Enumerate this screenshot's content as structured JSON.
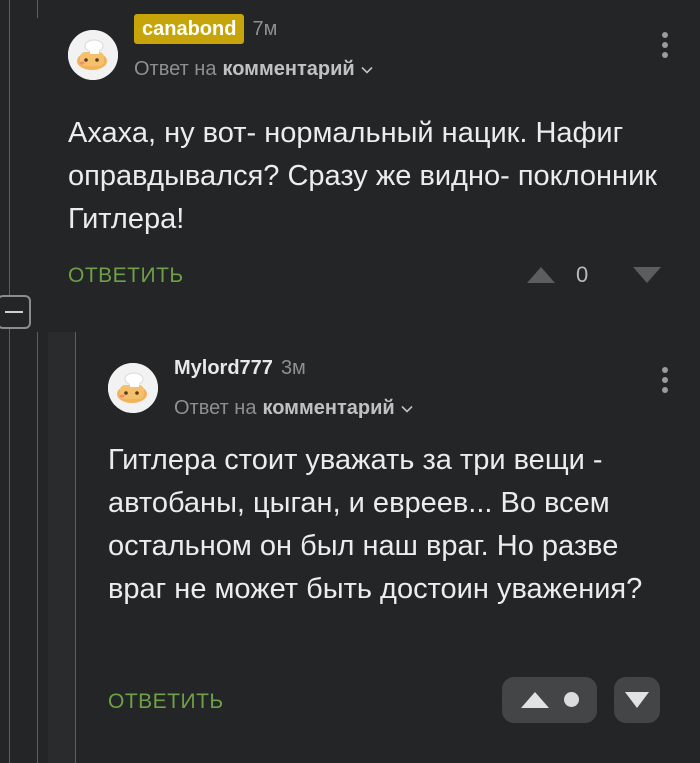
{
  "comments": [
    {
      "author": "canabond",
      "time": "7м",
      "reply_prefix": "Ответ на",
      "reply_target": "комментарий",
      "text": "Ахаха, ну вот- нормальный нацик. Нафиг оправдывался? Сразу же видно- поклонник Гитлера!",
      "reply_label": "ОТВЕТИТЬ",
      "score": "0"
    },
    {
      "author": "Mylord777",
      "time": "3м",
      "reply_prefix": "Ответ на",
      "reply_target": "комментарий",
      "text": "Гитлера стоит уважать за три вещи - автобаны, цыган, и евреев... Во всем остальном он был наш враг. Но разве враг не может быть достоин уважения?",
      "reply_label": "ОТВЕТИТЬ"
    }
  ],
  "colors": {
    "background": "#242526",
    "author_badge": "#c6a40a",
    "reply_link": "#6da047"
  },
  "icons": [
    "more-vertical-icon",
    "chevron-down-icon",
    "upvote-icon",
    "downvote-icon",
    "collapse-thread-icon"
  ]
}
